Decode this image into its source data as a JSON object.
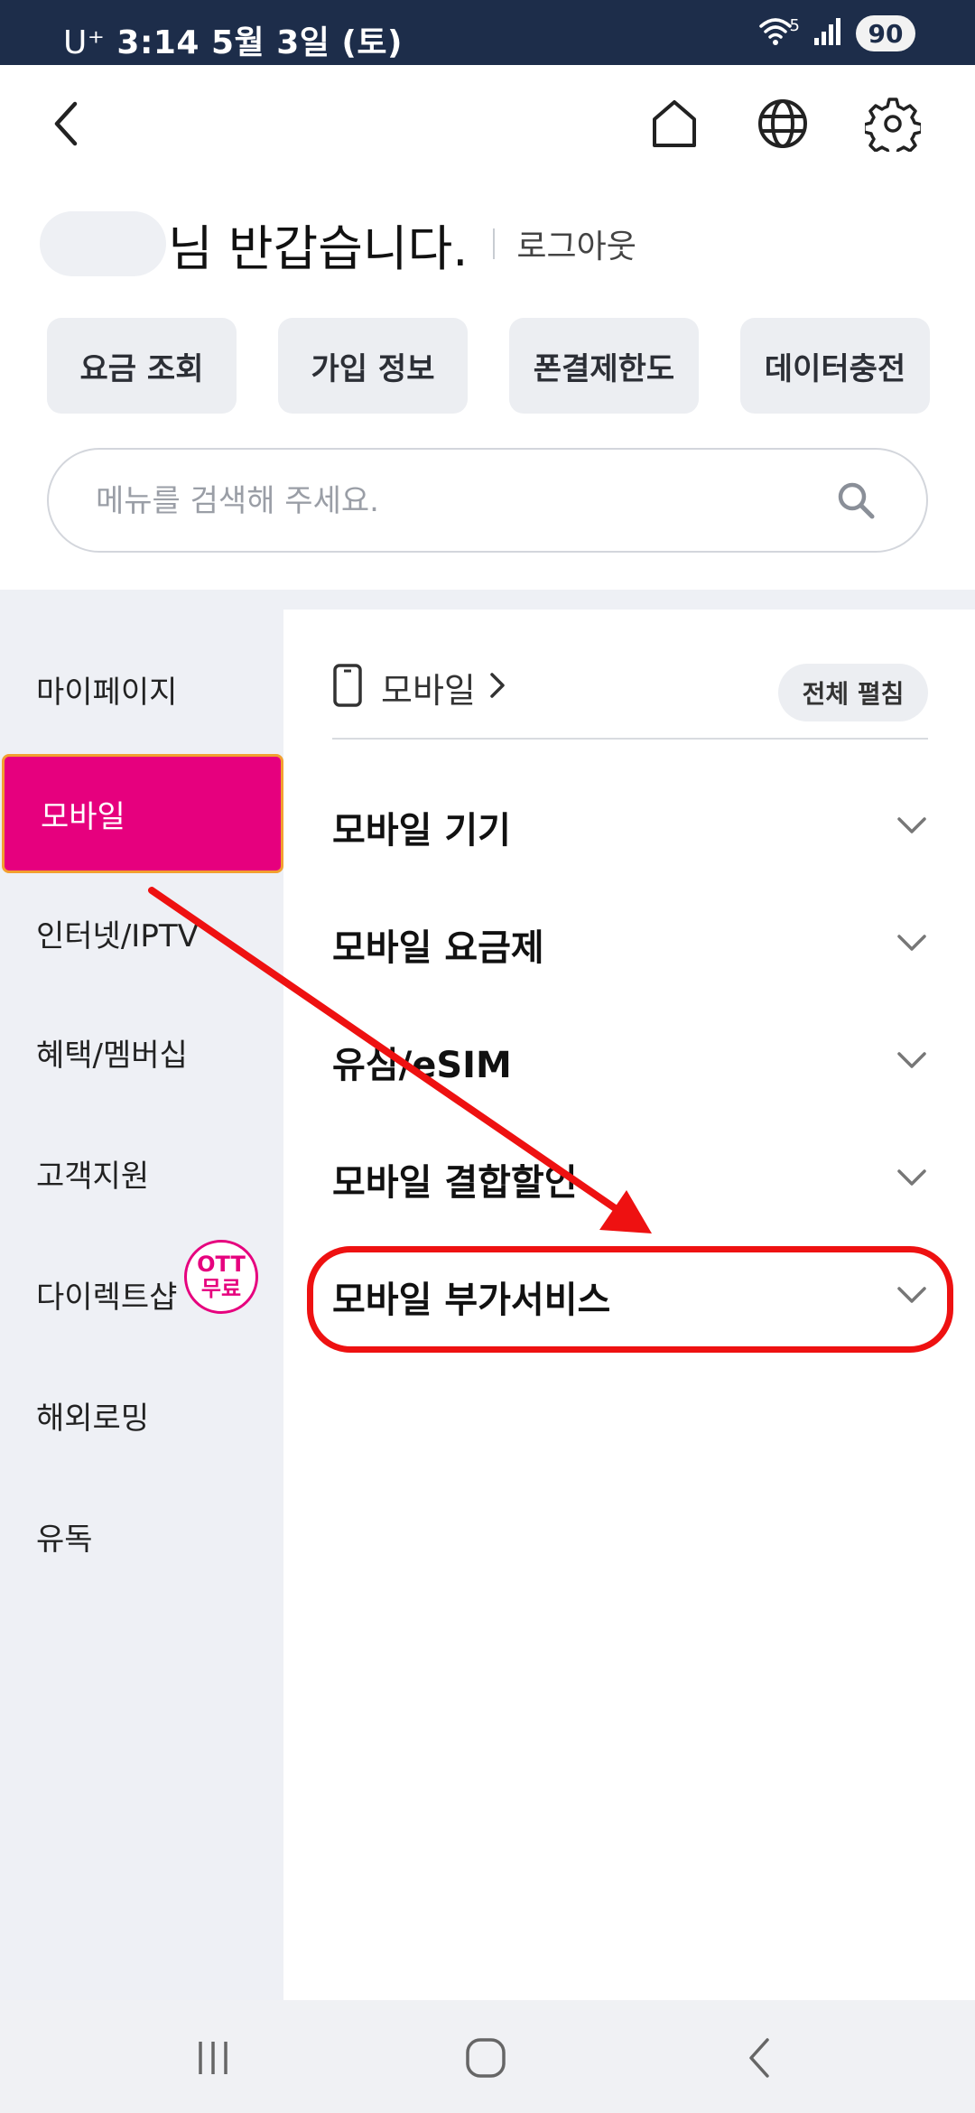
{
  "status_bar": {
    "carrier": "U⁺",
    "time": "3:14",
    "date": "5월 3일 (토)",
    "battery": "90",
    "network_label": "5"
  },
  "header": {
    "icons": [
      "back-arrow-icon",
      "home-icon",
      "globe-icon",
      "settings-gear-icon"
    ]
  },
  "greeting": {
    "text": "님 반갑습니다.",
    "logout_label": "로그아웃"
  },
  "quick_actions": [
    {
      "label": "요금 조회"
    },
    {
      "label": "가입 정보"
    },
    {
      "label": "폰결제한도"
    },
    {
      "label": "데이터충전"
    }
  ],
  "search": {
    "placeholder": "메뉴를 검색해 주세요.",
    "value": ""
  },
  "sidebar": {
    "items": [
      {
        "label": "마이페이지"
      },
      {
        "label": "모바일"
      },
      {
        "label": "인터넷/IPTV"
      },
      {
        "label": "혜택/멤버십"
      },
      {
        "label": "고객지원"
      },
      {
        "label": "다이렉트샵"
      },
      {
        "label": "해외로밍"
      },
      {
        "label": "유독"
      }
    ],
    "active_index": 1,
    "badge": {
      "line1": "OTT",
      "line2": "무료"
    }
  },
  "main": {
    "title": "모바일",
    "expand_all_label": "전체 펼침",
    "categories": [
      {
        "label": "모바일 기기"
      },
      {
        "label": "모바일 요금제"
      },
      {
        "label": "유심/eSIM"
      },
      {
        "label": "모바일 결합할인"
      },
      {
        "label": "모바일 부가서비스"
      }
    ],
    "highlighted_index": 4
  },
  "colors": {
    "status_bar": "#1d2d4a",
    "accent": "#e6007e",
    "active_border": "#f2a030",
    "annotation": "#ee1111",
    "sidebar_bg": "#eef0f5"
  }
}
